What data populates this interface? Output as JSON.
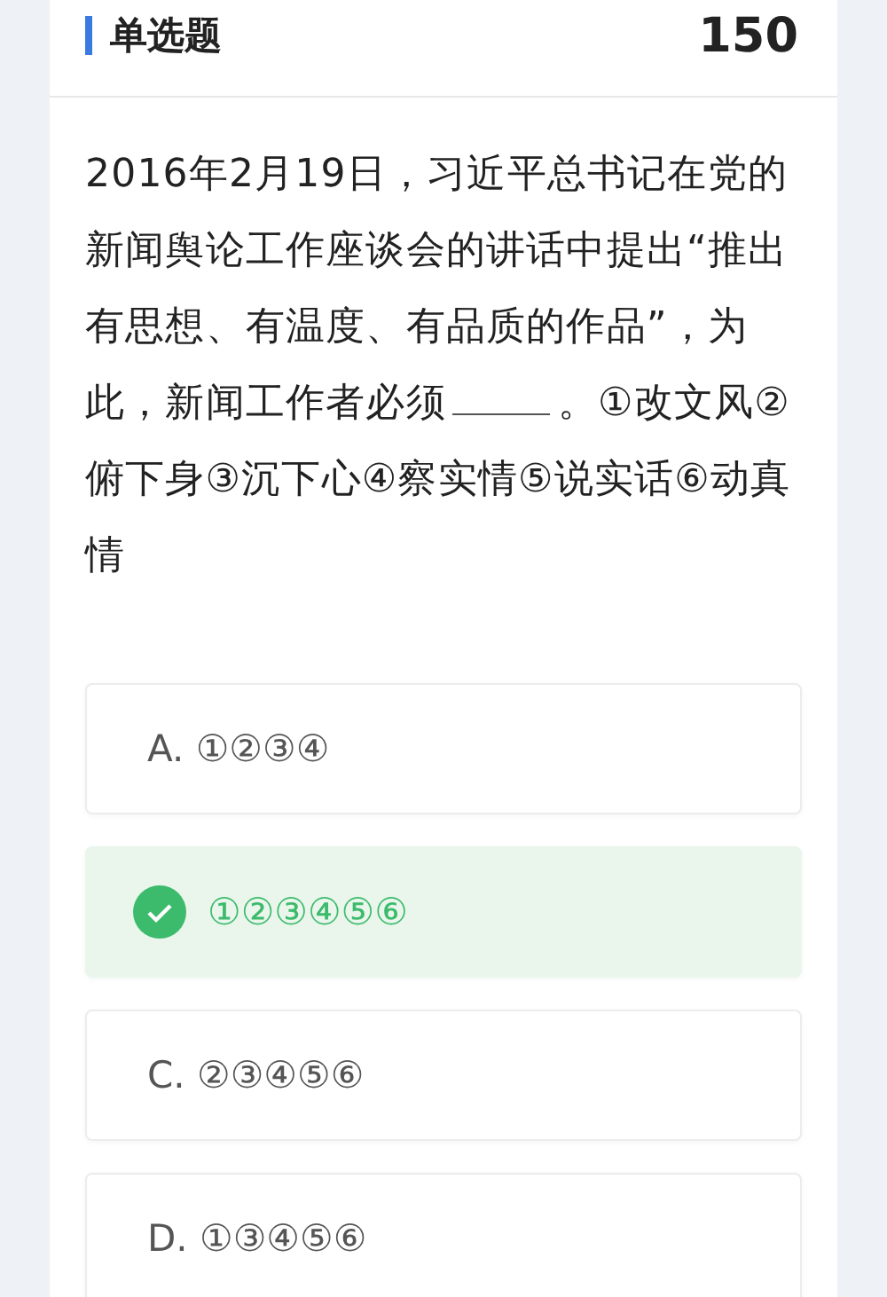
{
  "header": {
    "title": "单选题",
    "count": "150"
  },
  "question": {
    "before": "2016年2月19日，习近平总书记在党的新闻舆论工作座谈会的讲话中提出“推出有思想、有温度、有品质的作品”，为此，新闻工作者必须",
    "after": "。①改文风②俯下身③沉下心④察实情⑤说实话⑥动真情"
  },
  "options": [
    {
      "letter": "A.",
      "text": "①②③④",
      "selected": false
    },
    {
      "text": "①②③④⑤⑥",
      "selected": true
    },
    {
      "letter": "C.",
      "text": "②③④⑤⑥",
      "selected": false
    },
    {
      "letter": "D.",
      "text": "①③④⑤⑥",
      "selected": false
    }
  ]
}
